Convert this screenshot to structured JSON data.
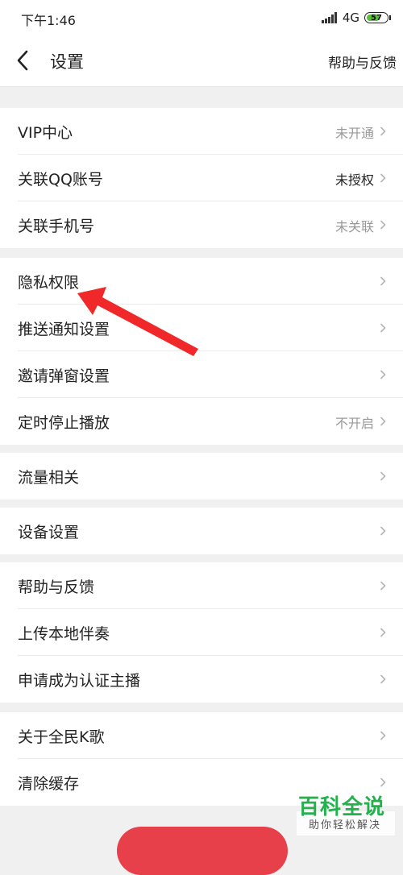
{
  "status": {
    "time": "下午1:46",
    "network": "4G",
    "battery": "57"
  },
  "header": {
    "title": "设置",
    "help_link": "帮助与反馈"
  },
  "groups": [
    {
      "items": [
        {
          "label": "VIP中心",
          "value": "未开通"
        },
        {
          "label": "关联QQ账号",
          "value": "未授权"
        },
        {
          "label": "关联手机号",
          "value": "未关联"
        }
      ]
    },
    {
      "items": [
        {
          "label": "隐私权限",
          "value": ""
        },
        {
          "label": "推送通知设置",
          "value": ""
        },
        {
          "label": "邀请弹窗设置",
          "value": ""
        },
        {
          "label": "定时停止播放",
          "value": "不开启"
        }
      ]
    },
    {
      "items": [
        {
          "label": "流量相关",
          "value": ""
        }
      ]
    },
    {
      "items": [
        {
          "label": "设备设置",
          "value": ""
        }
      ]
    },
    {
      "items": [
        {
          "label": "帮助与反馈",
          "value": ""
        },
        {
          "label": "上传本地伴奏",
          "value": ""
        },
        {
          "label": "申请成为认证主播",
          "value": ""
        }
      ]
    },
    {
      "items": [
        {
          "label": "关于全民K歌",
          "value": ""
        },
        {
          "label": "清除缓存",
          "value": ""
        }
      ]
    }
  ],
  "watermark": {
    "main": "百科全说",
    "sub": "助你轻松解决"
  },
  "colors": {
    "accent": "#e8404a",
    "annotation_arrow": "#f0282a",
    "watermark_green": "#22b14c"
  }
}
